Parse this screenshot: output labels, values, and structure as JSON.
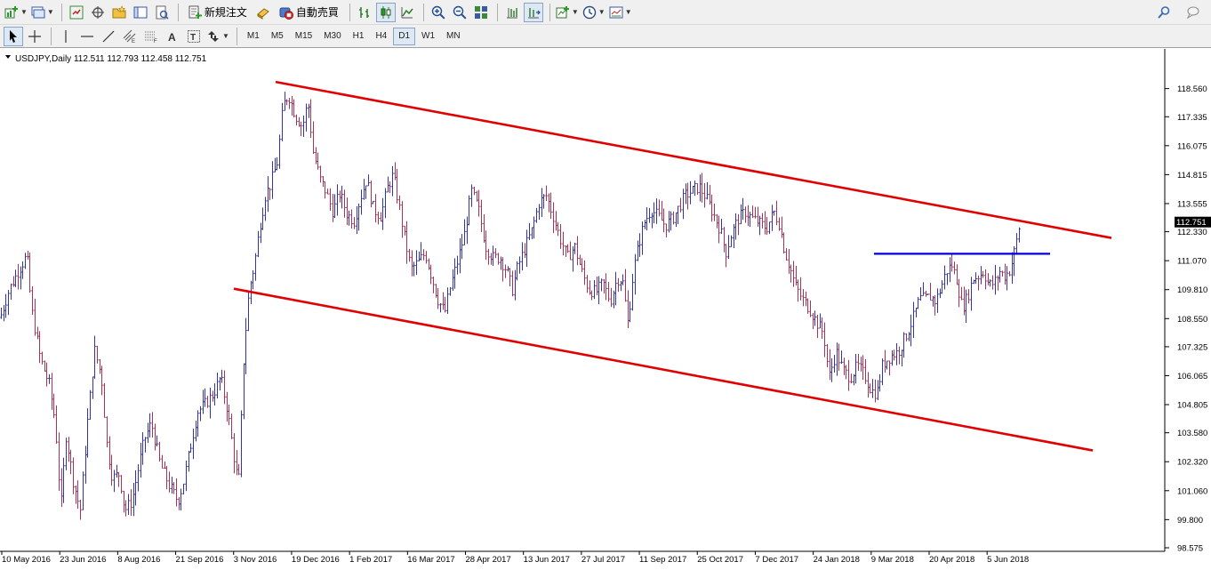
{
  "toolbar": {
    "new_order_label": "新規注文",
    "auto_trade_label": "自動売買"
  },
  "timeframes": [
    "M1",
    "M5",
    "M15",
    "M30",
    "H1",
    "H4",
    "D1",
    "W1",
    "MN"
  ],
  "active_timeframe": "D1",
  "chart": {
    "header": "USDJPY,Daily  112.511 112.793 112.458 112.751",
    "current_price_label": "112.751"
  },
  "colors": {
    "bull": "#3333aa",
    "bear": "#aa3355",
    "trendline": "#e00000",
    "level": "#0000dd",
    "price_tag_bg": "#000000"
  },
  "chart_data": {
    "type": "bar",
    "symbol": "USDJPY",
    "period": "Daily",
    "ohlc_last": {
      "open": 112.511,
      "high": 112.793,
      "low": 112.458,
      "close": 112.751
    },
    "y_ticks": [
      118.56,
      117.335,
      116.075,
      114.815,
      113.555,
      112.33,
      111.07,
      109.81,
      108.55,
      107.325,
      106.065,
      104.805,
      103.58,
      102.32,
      101.06,
      99.8,
      98.575
    ],
    "ylim": [
      98.575,
      119.9
    ],
    "x_ticks": [
      "10 May 2016",
      "23 Jun 2016",
      "8 Aug 2016",
      "21 Sep 2016",
      "3 Nov 2016",
      "19 Dec 2016",
      "1 Feb 2017",
      "16 Mar 2017",
      "28 Apr 2017",
      "13 Jun 2017",
      "27 Jul 2017",
      "11 Sep 2017",
      "25 Oct 2017",
      "7 Dec 2017",
      "24 Jan 2018",
      "9 Mar 2018",
      "20 Apr 2018",
      "5 Jun 2018"
    ],
    "price_path": [
      [
        0,
        108.6
      ],
      [
        10,
        109.8
      ],
      [
        20,
        110.6
      ],
      [
        30,
        111.3
      ],
      [
        35,
        109.0
      ],
      [
        45,
        106.8
      ],
      [
        55,
        105.7
      ],
      [
        62,
        104.0
      ],
      [
        68,
        100.3
      ],
      [
        74,
        103.5
      ],
      [
        82,
        101.5
      ],
      [
        90,
        100.2
      ],
      [
        98,
        104.0
      ],
      [
        106,
        107.2
      ],
      [
        114,
        106.0
      ],
      [
        120,
        103.0
      ],
      [
        126,
        101.6
      ],
      [
        134,
        101.8
      ],
      [
        140,
        100.2
      ],
      [
        148,
        100.6
      ],
      [
        155,
        102.0
      ],
      [
        162,
        103.3
      ],
      [
        170,
        104.0
      ],
      [
        180,
        102.2
      ],
      [
        190,
        101.3
      ],
      [
        200,
        100.6
      ],
      [
        206,
        101.4
      ],
      [
        214,
        103.0
      ],
      [
        222,
        104.5
      ],
      [
        230,
        104.8
      ],
      [
        240,
        105.3
      ],
      [
        248,
        106.0
      ],
      [
        256,
        104.5
      ],
      [
        264,
        102.2
      ],
      [
        268,
        101.3
      ],
      [
        274,
        107.0
      ],
      [
        280,
        109.8
      ],
      [
        286,
        110.9
      ],
      [
        292,
        112.6
      ],
      [
        298,
        113.9
      ],
      [
        304,
        114.4
      ],
      [
        312,
        115.4
      ],
      [
        318,
        117.8
      ],
      [
        324,
        118.3
      ],
      [
        332,
        117.4
      ],
      [
        340,
        116.9
      ],
      [
        346,
        118.0
      ],
      [
        352,
        115.8
      ],
      [
        360,
        114.6
      ],
      [
        366,
        114.1
      ],
      [
        374,
        113.2
      ],
      [
        382,
        114.0
      ],
      [
        390,
        113.1
      ],
      [
        398,
        112.8
      ],
      [
        405,
        113.8
      ],
      [
        412,
        114.6
      ],
      [
        420,
        113.3
      ],
      [
        428,
        113.0
      ],
      [
        436,
        114.3
      ],
      [
        442,
        114.8
      ],
      [
        448,
        113.6
      ],
      [
        455,
        112.0
      ],
      [
        462,
        110.7
      ],
      [
        470,
        111.0
      ],
      [
        478,
        111.4
      ],
      [
        485,
        110.4
      ],
      [
        492,
        109.4
      ],
      [
        500,
        108.8
      ],
      [
        506,
        109.9
      ],
      [
        514,
        111.0
      ],
      [
        522,
        112.2
      ],
      [
        530,
        114.1
      ],
      [
        538,
        113.3
      ],
      [
        546,
        111.7
      ],
      [
        554,
        111.2
      ],
      [
        562,
        111.2
      ],
      [
        570,
        110.6
      ],
      [
        576,
        109.8
      ],
      [
        582,
        110.8
      ],
      [
        590,
        111.6
      ],
      [
        598,
        112.4
      ],
      [
        606,
        113.6
      ],
      [
        614,
        113.9
      ],
      [
        622,
        113.0
      ],
      [
        630,
        112.0
      ],
      [
        638,
        111.2
      ],
      [
        646,
        111.7
      ],
      [
        654,
        110.6
      ],
      [
        662,
        109.8
      ],
      [
        670,
        109.7
      ],
      [
        678,
        110.1
      ],
      [
        686,
        109.3
      ],
      [
        694,
        110.3
      ],
      [
        700,
        110.2
      ],
      [
        706,
        108.3
      ],
      [
        712,
        110.6
      ],
      [
        718,
        111.8
      ],
      [
        724,
        112.7
      ],
      [
        732,
        113.3
      ],
      [
        740,
        113.0
      ],
      [
        748,
        112.6
      ],
      [
        756,
        112.9
      ],
      [
        762,
        113.3
      ],
      [
        770,
        113.9
      ],
      [
        778,
        114.1
      ],
      [
        786,
        114.3
      ],
      [
        794,
        113.8
      ],
      [
        802,
        113.1
      ],
      [
        810,
        112.4
      ],
      [
        816,
        111.4
      ],
      [
        822,
        112.2
      ],
      [
        830,
        112.9
      ],
      [
        838,
        113.2
      ],
      [
        846,
        112.9
      ],
      [
        854,
        112.7
      ],
      [
        862,
        112.5
      ],
      [
        870,
        113.2
      ],
      [
        876,
        112.7
      ],
      [
        882,
        111.5
      ],
      [
        888,
        110.8
      ],
      [
        894,
        110.0
      ],
      [
        902,
        109.4
      ],
      [
        910,
        109.0
      ],
      [
        918,
        108.4
      ],
      [
        926,
        107.9
      ],
      [
        932,
        106.0
      ],
      [
        940,
        107.1
      ],
      [
        948,
        106.3
      ],
      [
        956,
        106.0
      ],
      [
        964,
        106.5
      ],
      [
        972,
        106.1
      ],
      [
        980,
        105.4
      ],
      [
        986,
        105.3
      ],
      [
        992,
        106.5
      ],
      [
        998,
        106.8
      ],
      [
        1004,
        107.0
      ],
      [
        1010,
        107.1
      ],
      [
        1016,
        107.6
      ],
      [
        1022,
        108.1
      ],
      [
        1028,
        108.7
      ],
      [
        1034,
        109.4
      ],
      [
        1040,
        109.4
      ],
      [
        1046,
        109.5
      ],
      [
        1052,
        109.3
      ],
      [
        1058,
        109.9
      ],
      [
        1064,
        110.6
      ],
      [
        1070,
        110.9
      ],
      [
        1076,
        110.2
      ],
      [
        1082,
        109.0
      ],
      [
        1088,
        109.5
      ],
      [
        1094,
        110.3
      ],
      [
        1100,
        110.4
      ],
      [
        1106,
        110.6
      ],
      [
        1112,
        110.0
      ],
      [
        1118,
        110.1
      ],
      [
        1124,
        110.6
      ],
      [
        1130,
        110.4
      ],
      [
        1136,
        110.7
      ],
      [
        1142,
        111.7
      ],
      [
        1147,
        112.75
      ]
    ],
    "trendlines": [
      {
        "color": "red",
        "points": [
          [
            310,
            118.85
          ],
          [
            1250,
            112.06
          ]
        ]
      },
      {
        "color": "red",
        "points": [
          [
            263,
            109.85
          ],
          [
            1229,
            102.81
          ]
        ]
      },
      {
        "color": "blue",
        "points": [
          [
            983,
            111.37
          ],
          [
            1181,
            111.37
          ]
        ]
      }
    ]
  }
}
